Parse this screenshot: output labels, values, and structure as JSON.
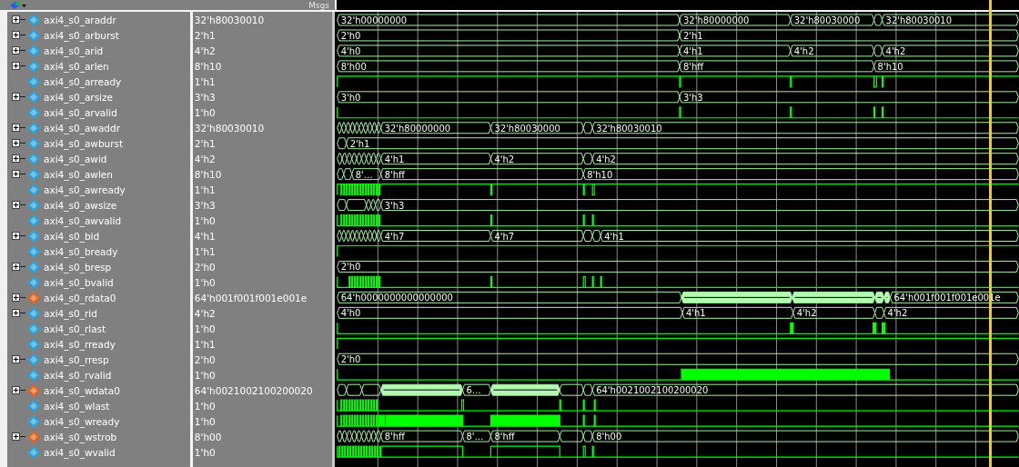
{
  "header": {
    "value_column": "Msgs"
  },
  "signals": [
    {
      "name": "axi4_s0_araddr",
      "value": "32'h80030010",
      "kind": "bus",
      "expanded": false,
      "color": "#29a3dc",
      "wave": [
        "32'h00000000",
        "32'h80000000",
        "32'h80030000",
        "32'h80030010"
      ]
    },
    {
      "name": "axi4_s0_arburst",
      "value": "2'h1",
      "kind": "bus",
      "expanded": false,
      "color": "#29a3dc",
      "wave": [
        "2'h0",
        "2'h1"
      ]
    },
    {
      "name": "axi4_s0_arid",
      "value": "4'h2",
      "kind": "bus",
      "expanded": false,
      "color": "#29a3dc",
      "wave": [
        "4'h0",
        "4'h1",
        "4'h2",
        "4'h2"
      ]
    },
    {
      "name": "axi4_s0_arlen",
      "value": "8'h10",
      "kind": "bus",
      "expanded": false,
      "color": "#29a3dc",
      "wave": [
        "8'h00",
        "8'hff",
        "8'h10"
      ]
    },
    {
      "name": "axi4_s0_arready",
      "value": "1'h1",
      "kind": "bit",
      "color": "#29a3dc"
    },
    {
      "name": "axi4_s0_arsize",
      "value": "3'h3",
      "kind": "bus",
      "expanded": false,
      "color": "#29a3dc",
      "wave": [
        "3'h0",
        "3'h3"
      ]
    },
    {
      "name": "axi4_s0_arvalid",
      "value": "1'h0",
      "kind": "bit",
      "color": "#29a3dc"
    },
    {
      "name": "axi4_s0_awaddr",
      "value": "32'h80030010",
      "kind": "bus",
      "expanded": false,
      "color": "#29a3dc",
      "wave": [
        "32'h80000000",
        "32'h80030000",
        "32'h80030010"
      ]
    },
    {
      "name": "axi4_s0_awburst",
      "value": "2'h1",
      "kind": "bus",
      "expanded": false,
      "color": "#29a3dc",
      "wave": [
        "2'h1"
      ]
    },
    {
      "name": "axi4_s0_awid",
      "value": "4'h2",
      "kind": "bus",
      "expanded": false,
      "color": "#29a3dc",
      "wave": [
        "4'h1",
        "4'h2",
        "4'h2"
      ]
    },
    {
      "name": "axi4_s0_awlen",
      "value": "8'h10",
      "kind": "bus",
      "expanded": false,
      "color": "#29a3dc",
      "wave": [
        "8'…",
        "8'hff",
        "8'h10"
      ]
    },
    {
      "name": "axi4_s0_awready",
      "value": "1'h1",
      "kind": "bit",
      "color": "#29a3dc"
    },
    {
      "name": "axi4_s0_awsize",
      "value": "3'h3",
      "kind": "bus",
      "expanded": false,
      "color": "#29a3dc",
      "wave": [
        "3'h3"
      ]
    },
    {
      "name": "axi4_s0_awvalid",
      "value": "1'h0",
      "kind": "bit",
      "color": "#29a3dc"
    },
    {
      "name": "axi4_s0_bid",
      "value": "4'h1",
      "kind": "bus",
      "expanded": false,
      "color": "#29a3dc",
      "wave": [
        "4'h7",
        "4'h7",
        "4'h1"
      ]
    },
    {
      "name": "axi4_s0_bready",
      "value": "1'h1",
      "kind": "bit",
      "color": "#29a3dc"
    },
    {
      "name": "axi4_s0_bresp",
      "value": "2'h0",
      "kind": "bus",
      "expanded": false,
      "color": "#29a3dc",
      "wave": [
        "2'h0"
      ]
    },
    {
      "name": "axi4_s0_bvalid",
      "value": "1'h0",
      "kind": "bit",
      "color": "#29a3dc"
    },
    {
      "name": "axi4_s0_rdata0",
      "value": "64'h001f001f001e001e",
      "kind": "bus",
      "expanded": false,
      "color": "#e0641e",
      "wave": [
        "64'h0000000000000000",
        "64'h001f001f001e001e"
      ]
    },
    {
      "name": "axi4_s0_rid",
      "value": "4'h2",
      "kind": "bus",
      "expanded": false,
      "color": "#29a3dc",
      "wave": [
        "4'h0",
        "4'h1",
        "4'h2",
        "4'h2"
      ]
    },
    {
      "name": "axi4_s0_rlast",
      "value": "1'h0",
      "kind": "bit",
      "color": "#29a3dc"
    },
    {
      "name": "axi4_s0_rready",
      "value": "1'h1",
      "kind": "bit",
      "color": "#29a3dc"
    },
    {
      "name": "axi4_s0_rresp",
      "value": "2'h0",
      "kind": "bus",
      "expanded": false,
      "color": "#29a3dc",
      "wave": [
        "2'h0"
      ]
    },
    {
      "name": "axi4_s0_rvalid",
      "value": "1'h0",
      "kind": "bit",
      "color": "#29a3dc"
    },
    {
      "name": "axi4_s0_wdata0",
      "value": "64'h0021002100200020",
      "kind": "bus",
      "expanded": false,
      "color": "#e0641e",
      "wave": [
        "6…",
        "64'h0021002100200020"
      ]
    },
    {
      "name": "axi4_s0_wlast",
      "value": "1'h0",
      "kind": "bit",
      "color": "#29a3dc"
    },
    {
      "name": "axi4_s0_wready",
      "value": "1'h0",
      "kind": "bit",
      "color": "#29a3dc"
    },
    {
      "name": "axi4_s0_wstrob",
      "value": "8'h00",
      "kind": "bus",
      "expanded": false,
      "color": "#e0641e",
      "wave": [
        "8'hff",
        "8'…",
        "8'hff",
        "8'h00"
      ]
    },
    {
      "name": "axi4_s0_wvalid",
      "value": "1'h0",
      "kind": "bit",
      "color": "#29a3dc"
    }
  ]
}
